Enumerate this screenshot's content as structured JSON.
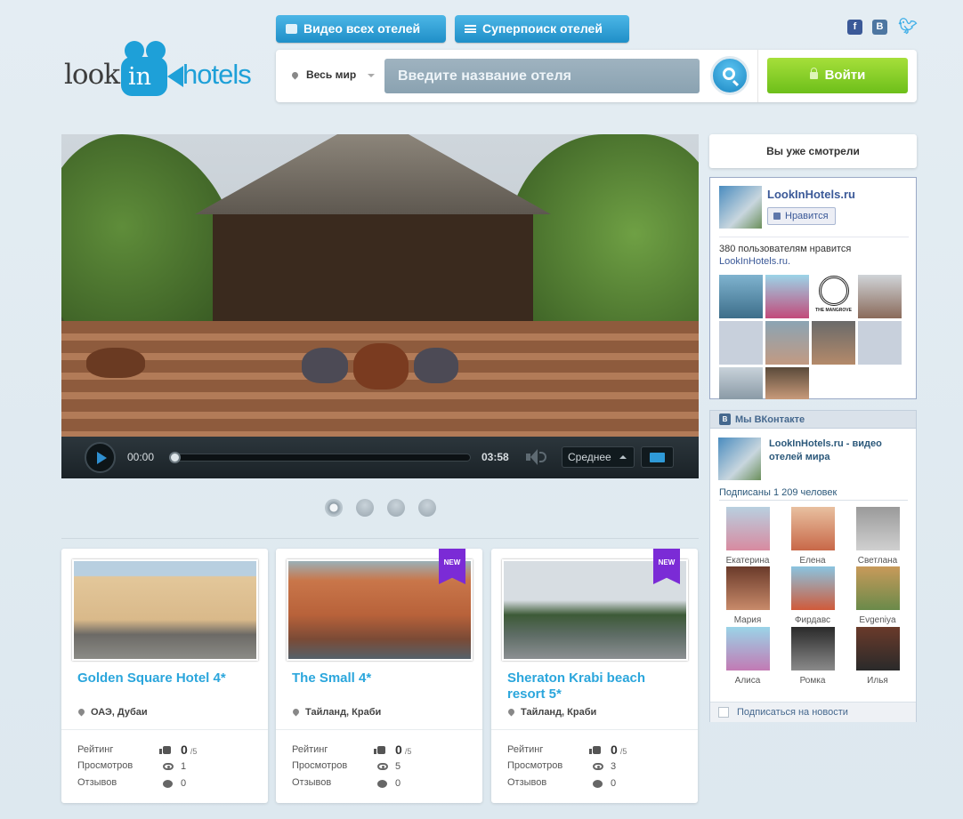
{
  "header": {
    "logo_parts": [
      "look",
      "in",
      "hotels"
    ],
    "btn_video": "Видео всех отелей",
    "btn_super": "Суперпоиск отелей",
    "social": {
      "fb": "f",
      "vk": "B",
      "tw": "twitter-bird-icon"
    }
  },
  "search": {
    "region": "Весь мир",
    "placeholder": "Введите название отеля",
    "login": "Войти"
  },
  "player": {
    "current_time": "00:00",
    "total_time": "03:58",
    "quality": "Среднее",
    "progress": 0
  },
  "slider": {
    "count": 4,
    "active": 0
  },
  "hotels": [
    {
      "title": "Golden Square Hotel 4*",
      "location": "ОАЭ, Дубаи",
      "is_new": false,
      "rating": "0",
      "rating_max": "/5",
      "views": "1",
      "reviews": "0"
    },
    {
      "title": "The Small 4*",
      "location": "Тайланд, Краби",
      "is_new": true,
      "rating": "0",
      "rating_max": "/5",
      "views": "5",
      "reviews": "0"
    },
    {
      "title": "Sheraton Krabi beach resort 5*",
      "location": "Тайланд, Краби",
      "is_new": true,
      "rating": "0",
      "rating_max": "/5",
      "views": "3",
      "reviews": "0"
    }
  ],
  "labels": {
    "rating": "Рейтинг",
    "views": "Просмотров",
    "reviews": "Отзывов",
    "new": "NEW"
  },
  "sidebar": {
    "already_watched": "Вы уже смотрели",
    "facebook": {
      "page_name": "LookInHotels.ru",
      "like_button": "Нравится",
      "count_text": "380 пользователям нравится",
      "count_link": "LookInHotels.ru.",
      "mangrove_text": "THE MANGROVE"
    },
    "vk": {
      "header": "Мы ВКонтакте",
      "title": "LookInHotels.ru - видео отелей мира",
      "subscribers": "Подписаны 1 209 человек",
      "members": [
        "Екатерина",
        "Елена",
        "Светлана",
        "Мария",
        "Фирдавс",
        "Evgeniya",
        "Алиса",
        "Ромка",
        "Илья"
      ],
      "subscribe_label": "Подписаться на новости"
    }
  },
  "colors": {
    "accent": "#2ba6dc",
    "login_green": "#7ac81f",
    "new_badge": "#7b2bd6",
    "vk_blue": "#45688e",
    "fb_blue": "#3b5998"
  }
}
